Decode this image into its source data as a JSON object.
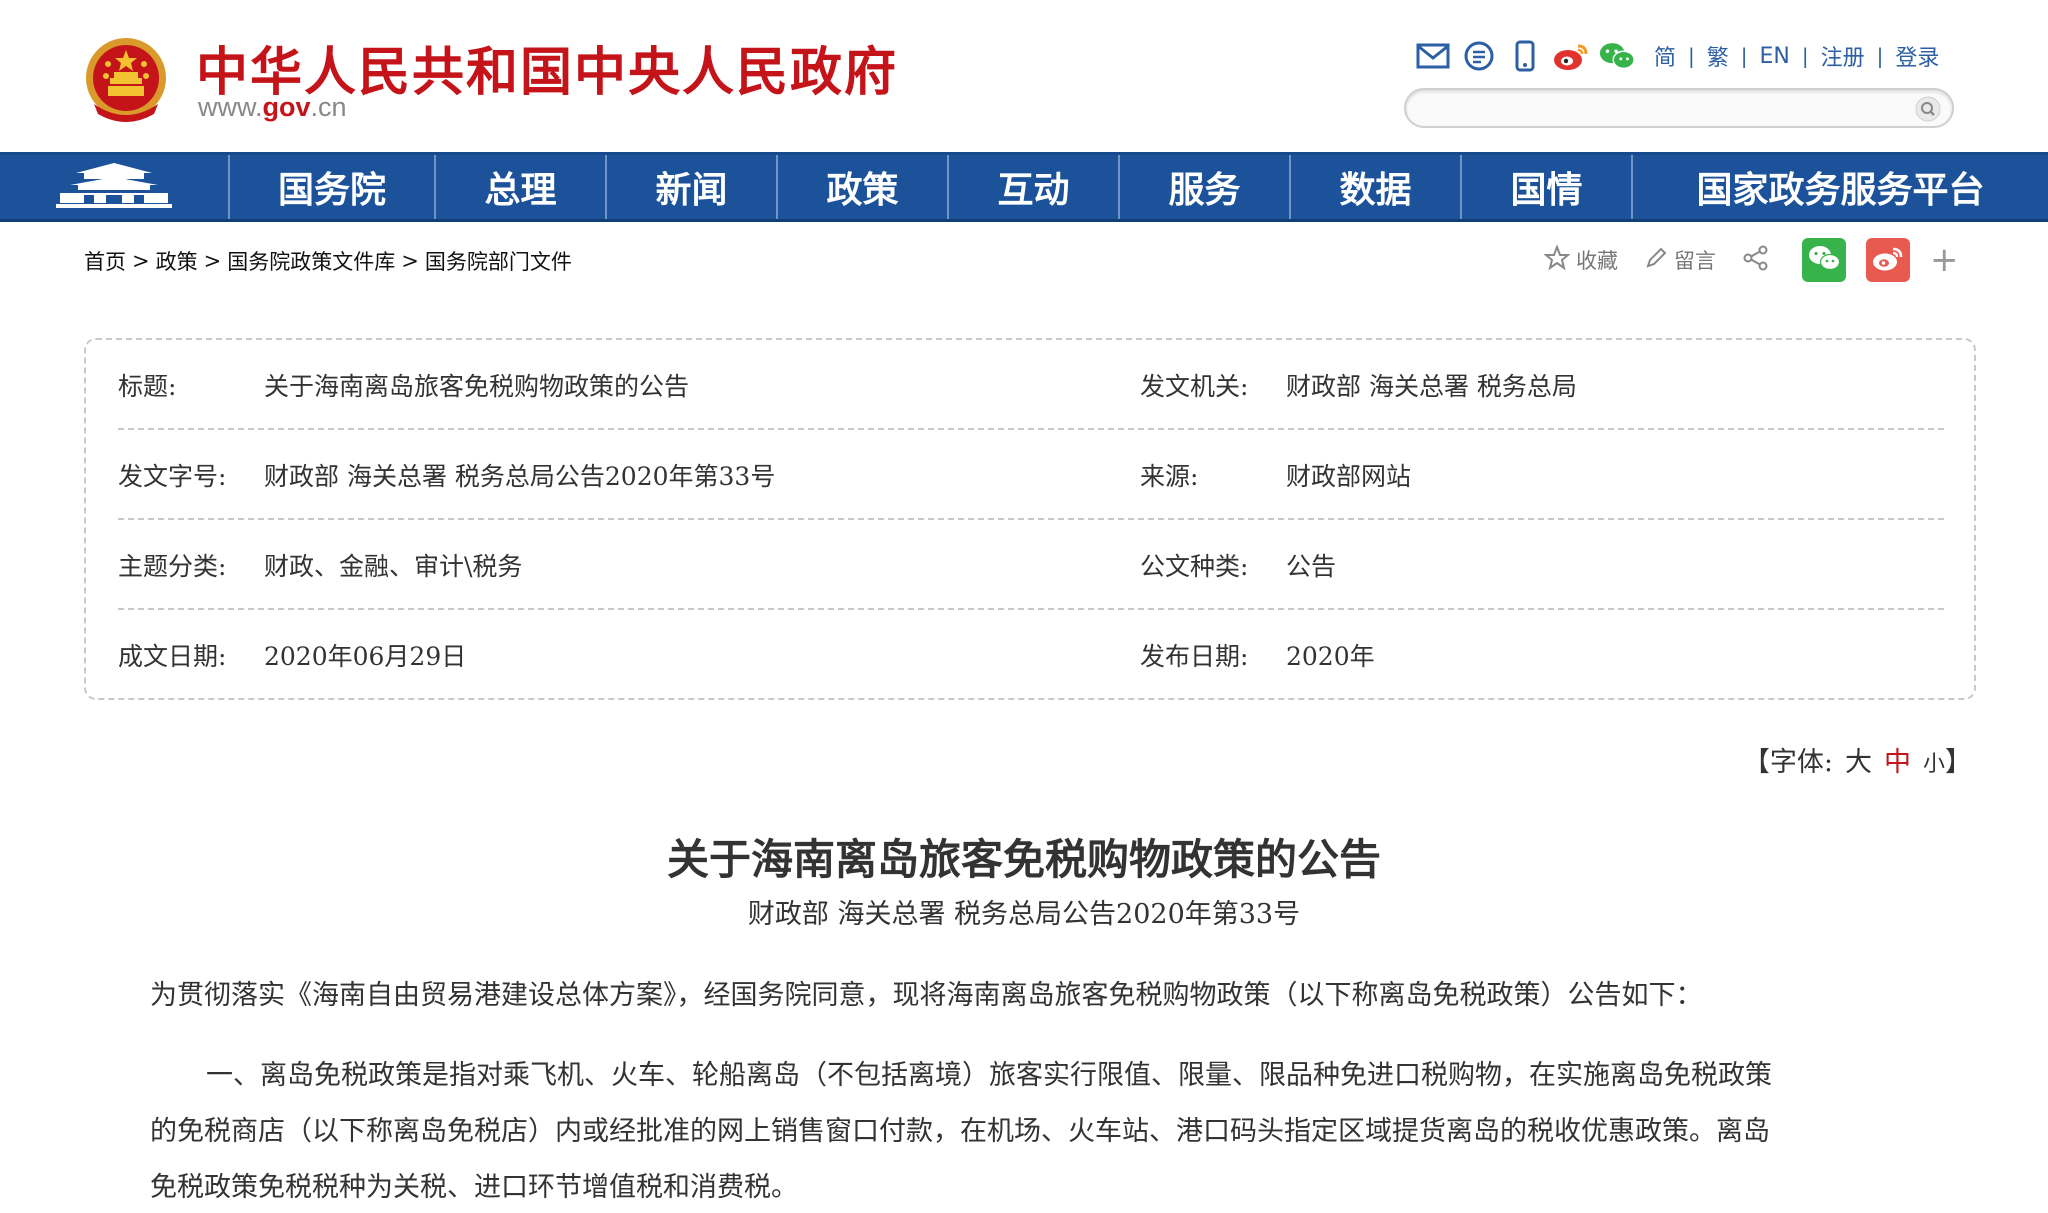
{
  "header": {
    "site_name": "中华人民共和国中央人民政府",
    "url_prefix": "www.",
    "url_domain": "gov",
    "url_suffix": ".cn",
    "toolbar_icons": [
      "mail-icon",
      "message-icon",
      "mobile-icon",
      "weibo-icon",
      "wechat-icon"
    ],
    "lang_links": [
      "简",
      "繁",
      "EN",
      "注册",
      "登录"
    ],
    "search_placeholder": "",
    "colors": {
      "brand_red": "#c4141a",
      "link_blue": "#2c5fa3"
    }
  },
  "nav": {
    "items": [
      "国务院",
      "总理",
      "新闻",
      "政策",
      "互动",
      "服务",
      "数据",
      "国情",
      "国家政务服务平台"
    ],
    "colors": {
      "background": "#1b5299"
    }
  },
  "breadcrumb": [
    "首页",
    "政策",
    "国务院政策文件库",
    "国务院部门文件"
  ],
  "breadcrumb_separator": ">",
  "share": {
    "favorite_label": "收藏",
    "comment_label": "留言"
  },
  "info": {
    "rows": [
      {
        "left_label_a": "标",
        "left_label_b": "题:",
        "left_value": "关于海南离岛旅客免税购物政策的公告",
        "right_label": "发文机关:",
        "right_value": "财政部 海关总署 税务总局"
      },
      {
        "left_label": "发文字号:",
        "left_value": "财政部 海关总署 税务总局公告2020年第33号",
        "right_label_a": "来",
        "right_label_b": "源:",
        "right_value": "财政部网站"
      },
      {
        "left_label": "主题分类:",
        "left_value": "财政、金融、审计\\税务",
        "right_label": "公文种类:",
        "right_value": "公告"
      },
      {
        "left_label": "成文日期:",
        "left_value": "2020年06月29日",
        "right_label": "发布日期:",
        "right_value": "2020年"
      }
    ]
  },
  "font_control": {
    "prefix": "【字体:",
    "large": "大",
    "medium": "中",
    "small": "小",
    "suffix": "】"
  },
  "article": {
    "title": "关于海南离岛旅客免税购物政策的公告",
    "subtitle": "财政部 海关总署 税务总局公告2020年第33号",
    "intro": "为贯彻落实《海南自由贸易港建设总体方案》，经国务院同意，现将海南离岛旅客免税购物政策（以下称离岛免税政策）公告如下：",
    "para1_line1": "一、离岛免税政策是指对乘飞机、火车、轮船离岛（不包括离境）旅客实行限值、限量、限品种免进口税购物，在实施离岛免税政策",
    "para1_line2": "的免税商店（以下称离岛免税店）内或经批准的网上销售窗口付款，在机场、火车站、港口码头指定区域提货离岛的税收优惠政策。离岛",
    "para1_line3": "免税政策免税税种为关税、进口环节增值税和消费税。"
  }
}
